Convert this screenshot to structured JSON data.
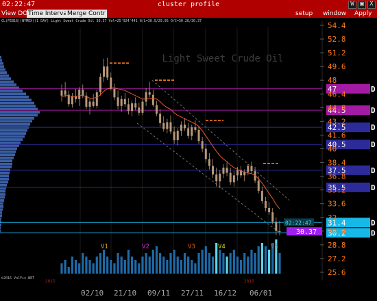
{
  "window": {
    "clock": "02:22:47",
    "title": "cluster profile",
    "controls": [
      "W",
      "▣",
      "X"
    ]
  },
  "menu": {
    "tabs": [
      "View DOM",
      "Time Interval",
      "Merge Contr"
    ],
    "right": [
      "setup",
      "window",
      "Apply"
    ]
  },
  "header_info": "CL(FEB16)(NYMEX)(1 DAY) Light Sweet Crude Oil 30.37 Vol=25'924'441 H/L=30.9/29.95 O/C=30.26/30.37",
  "watermark": "Light Sweet Crude Oil",
  "footer_left": "©2016 VolFix.NET",
  "colors": {
    "title_red": "#b00000",
    "price_orange": "#ff7a1a",
    "candle": "#b7987a",
    "ma_line": "#e25a30",
    "volume_blue": "#1e6aa8",
    "level_purple": "#a31aa3",
    "level_blue": "#2d2b9a",
    "level_cyan": "#16b8e8",
    "last_price": "#a020f0"
  },
  "chart_data": {
    "type": "candlestick",
    "y_ticks": [
      54.4,
      52.8,
      51.2,
      49.6,
      48,
      46.4,
      44.8,
      43.2,
      41.6,
      40,
      38.4,
      36.8,
      35.2,
      33.6,
      32,
      30.4,
      28.8,
      27.2,
      25.6
    ],
    "ylim": [
      25.0,
      55.0
    ],
    "x_ticks": [
      "02/10",
      "21/10",
      "09/11",
      "27/11",
      "16/12",
      "06/01"
    ],
    "year_marks": [
      "2015",
      "2016"
    ],
    "last_price": 30.37,
    "last_time": "02:22:47",
    "levels": [
      {
        "value": 47.0,
        "label": "47",
        "color": "#a31aa3"
      },
      {
        "value": 44.5,
        "label": "44.5",
        "color": "#a31aa3"
      },
      {
        "value": 42.5,
        "label": "42.5",
        "color": "#2d2b9a"
      },
      {
        "value": 40.5,
        "label": "40.5",
        "color": "#2d2b9a"
      },
      {
        "value": 37.5,
        "label": "37.5",
        "color": "#2d2b9a"
      },
      {
        "value": 35.5,
        "label": "35.5",
        "color": "#2d2b9a"
      },
      {
        "value": 31.4,
        "label": "31.4",
        "color": "#16b8e8"
      },
      {
        "value": 30.2,
        "label": "30.2",
        "color": "#16b8e8"
      }
    ],
    "level_flag": "D",
    "volume_labels": [
      {
        "label": "V1",
        "color": "#e2a030"
      },
      {
        "label": "V2",
        "color": "#d030d0"
      },
      {
        "label": "V3",
        "color": "#e05a20"
      },
      {
        "label": "V4",
        "color": "#d8d820"
      },
      {
        "label": "V5",
        "color": "#e05a20"
      }
    ],
    "resistance_marks": [
      50.0,
      48.0,
      43.3,
      38.3
    ],
    "candles": [
      {
        "o": 46.2,
        "h": 47.5,
        "l": 45.5,
        "c": 46.8
      },
      {
        "o": 46.8,
        "h": 47.8,
        "l": 46.0,
        "c": 46.3
      },
      {
        "o": 46.3,
        "h": 46.8,
        "l": 44.9,
        "c": 45.2
      },
      {
        "o": 45.2,
        "h": 46.5,
        "l": 44.8,
        "c": 46.1
      },
      {
        "o": 46.1,
        "h": 47.0,
        "l": 45.4,
        "c": 45.8
      },
      {
        "o": 45.8,
        "h": 47.2,
        "l": 45.0,
        "c": 46.9
      },
      {
        "o": 46.9,
        "h": 47.5,
        "l": 45.9,
        "c": 46.2
      },
      {
        "o": 46.2,
        "h": 46.6,
        "l": 44.6,
        "c": 44.9
      },
      {
        "o": 44.9,
        "h": 45.8,
        "l": 44.0,
        "c": 45.5
      },
      {
        "o": 45.5,
        "h": 46.4,
        "l": 44.8,
        "c": 45.0
      },
      {
        "o": 45.0,
        "h": 46.9,
        "l": 44.7,
        "c": 46.6
      },
      {
        "o": 46.6,
        "h": 48.8,
        "l": 46.2,
        "c": 48.4
      },
      {
        "o": 48.4,
        "h": 50.5,
        "l": 47.8,
        "c": 49.6
      },
      {
        "o": 49.6,
        "h": 50.6,
        "l": 48.0,
        "c": 48.3
      },
      {
        "o": 48.3,
        "h": 48.9,
        "l": 46.8,
        "c": 47.0
      },
      {
        "o": 47.0,
        "h": 47.6,
        "l": 45.7,
        "c": 46.0
      },
      {
        "o": 46.0,
        "h": 46.8,
        "l": 44.6,
        "c": 45.0
      },
      {
        "o": 45.0,
        "h": 46.2,
        "l": 44.3,
        "c": 45.8
      },
      {
        "o": 45.8,
        "h": 46.5,
        "l": 44.9,
        "c": 45.2
      },
      {
        "o": 45.2,
        "h": 45.9,
        "l": 44.0,
        "c": 44.4
      },
      {
        "o": 44.4,
        "h": 45.6,
        "l": 43.8,
        "c": 45.3
      },
      {
        "o": 45.3,
        "h": 46.0,
        "l": 44.5,
        "c": 44.8
      },
      {
        "o": 44.8,
        "h": 45.4,
        "l": 43.9,
        "c": 44.2
      },
      {
        "o": 44.2,
        "h": 45.8,
        "l": 43.9,
        "c": 45.5
      },
      {
        "o": 45.5,
        "h": 47.1,
        "l": 45.0,
        "c": 46.6
      },
      {
        "o": 46.6,
        "h": 47.8,
        "l": 46.0,
        "c": 46.3
      },
      {
        "o": 46.3,
        "h": 46.9,
        "l": 44.9,
        "c": 45.1
      },
      {
        "o": 45.1,
        "h": 45.6,
        "l": 43.8,
        "c": 44.1
      },
      {
        "o": 44.1,
        "h": 44.6,
        "l": 42.6,
        "c": 43.0
      },
      {
        "o": 43.0,
        "h": 43.8,
        "l": 42.0,
        "c": 42.3
      },
      {
        "o": 42.3,
        "h": 43.5,
        "l": 41.8,
        "c": 43.1
      },
      {
        "o": 43.1,
        "h": 43.9,
        "l": 41.7,
        "c": 42.0
      },
      {
        "o": 42.0,
        "h": 42.6,
        "l": 40.6,
        "c": 41.0
      },
      {
        "o": 41.0,
        "h": 42.4,
        "l": 40.4,
        "c": 42.1
      },
      {
        "o": 42.1,
        "h": 43.2,
        "l": 41.5,
        "c": 42.8
      },
      {
        "o": 42.8,
        "h": 43.6,
        "l": 42.1,
        "c": 42.4
      },
      {
        "o": 42.4,
        "h": 43.0,
        "l": 41.2,
        "c": 41.5
      },
      {
        "o": 41.5,
        "h": 42.8,
        "l": 41.0,
        "c": 42.5
      },
      {
        "o": 42.5,
        "h": 43.3,
        "l": 41.9,
        "c": 42.2
      },
      {
        "o": 42.2,
        "h": 42.7,
        "l": 40.6,
        "c": 40.9
      },
      {
        "o": 40.9,
        "h": 41.4,
        "l": 39.6,
        "c": 40.0
      },
      {
        "o": 40.0,
        "h": 40.6,
        "l": 38.4,
        "c": 38.8
      },
      {
        "o": 38.8,
        "h": 39.5,
        "l": 37.6,
        "c": 38.0
      },
      {
        "o": 38.0,
        "h": 38.8,
        "l": 36.6,
        "c": 37.0
      },
      {
        "o": 37.0,
        "h": 37.8,
        "l": 35.6,
        "c": 36.2
      },
      {
        "o": 36.2,
        "h": 37.5,
        "l": 35.4,
        "c": 37.1
      },
      {
        "o": 37.1,
        "h": 38.2,
        "l": 36.6,
        "c": 37.8
      },
      {
        "o": 37.8,
        "h": 38.4,
        "l": 36.8,
        "c": 37.2
      },
      {
        "o": 37.2,
        "h": 37.8,
        "l": 35.8,
        "c": 36.1
      },
      {
        "o": 36.1,
        "h": 37.4,
        "l": 35.6,
        "c": 36.9
      },
      {
        "o": 36.9,
        "h": 37.9,
        "l": 36.3,
        "c": 37.5
      },
      {
        "o": 37.5,
        "h": 38.0,
        "l": 36.6,
        "c": 36.9
      },
      {
        "o": 36.9,
        "h": 37.6,
        "l": 36.2,
        "c": 37.3
      },
      {
        "o": 37.3,
        "h": 38.2,
        "l": 36.9,
        "c": 38.0
      },
      {
        "o": 38.0,
        "h": 38.5,
        "l": 37.1,
        "c": 37.4
      },
      {
        "o": 37.4,
        "h": 37.9,
        "l": 36.0,
        "c": 36.3
      },
      {
        "o": 36.3,
        "h": 36.8,
        "l": 34.8,
        "c": 35.1
      },
      {
        "o": 35.1,
        "h": 35.6,
        "l": 33.6,
        "c": 33.9
      },
      {
        "o": 33.9,
        "h": 34.4,
        "l": 32.7,
        "c": 33.1
      },
      {
        "o": 33.1,
        "h": 33.8,
        "l": 32.3,
        "c": 32.6
      },
      {
        "o": 32.6,
        "h": 33.1,
        "l": 31.2,
        "c": 31.5
      },
      {
        "o": 31.5,
        "h": 32.0,
        "l": 29.9,
        "c": 30.4
      },
      {
        "o": 30.4,
        "h": 31.6,
        "l": 29.9,
        "c": 30.4
      }
    ],
    "ma": [
      46.1,
      46.2,
      46.2,
      46.1,
      46.1,
      46.2,
      46.2,
      46.1,
      45.9,
      45.9,
      46.0,
      46.3,
      46.7,
      47.0,
      47.1,
      47.1,
      47.0,
      46.9,
      46.8,
      46.6,
      46.4,
      46.2,
      46.0,
      45.8,
      45.8,
      45.9,
      45.9,
      45.8,
      45.5,
      45.1,
      44.8,
      44.6,
      44.2,
      43.9,
      43.7,
      43.5,
      43.3,
      43.1,
      42.9,
      42.6,
      42.1,
      41.5,
      40.9,
      40.3,
      39.7,
      39.2,
      38.8,
      38.5,
      38.1,
      37.8,
      37.6,
      37.4,
      37.3,
      37.2,
      37.1,
      36.9,
      36.5,
      36.0,
      35.4,
      34.8,
      34.2,
      33.5,
      33.0
    ],
    "volume": [
      3,
      4,
      2,
      5,
      4,
      3,
      6,
      5,
      4,
      3,
      5,
      6,
      7,
      5,
      4,
      3,
      6,
      5,
      4,
      7,
      5,
      4,
      3,
      5,
      6,
      5,
      7,
      8,
      6,
      5,
      4,
      6,
      7,
      5,
      4,
      6,
      5,
      4,
      3,
      6,
      7,
      8,
      6,
      5,
      9,
      7,
      6,
      5,
      6,
      7,
      5,
      4,
      6,
      5,
      7,
      6,
      8,
      9,
      8,
      7,
      9,
      10,
      6
    ],
    "volume_highlight_index": [
      44,
      47,
      57,
      59,
      61
    ],
    "profile": [
      2,
      3,
      5,
      6,
      8,
      10,
      13,
      16,
      20,
      24,
      28,
      33,
      38,
      42,
      46,
      50,
      52,
      55,
      58,
      55,
      50,
      47,
      44,
      42,
      40,
      38,
      36,
      33,
      30,
      28,
      25,
      23,
      22,
      20,
      18,
      18,
      17,
      15,
      14,
      13,
      13,
      12,
      10,
      9,
      8,
      8,
      7,
      6,
      5,
      5,
      4,
      3,
      3,
      2,
      2,
      2,
      1,
      1
    ]
  }
}
